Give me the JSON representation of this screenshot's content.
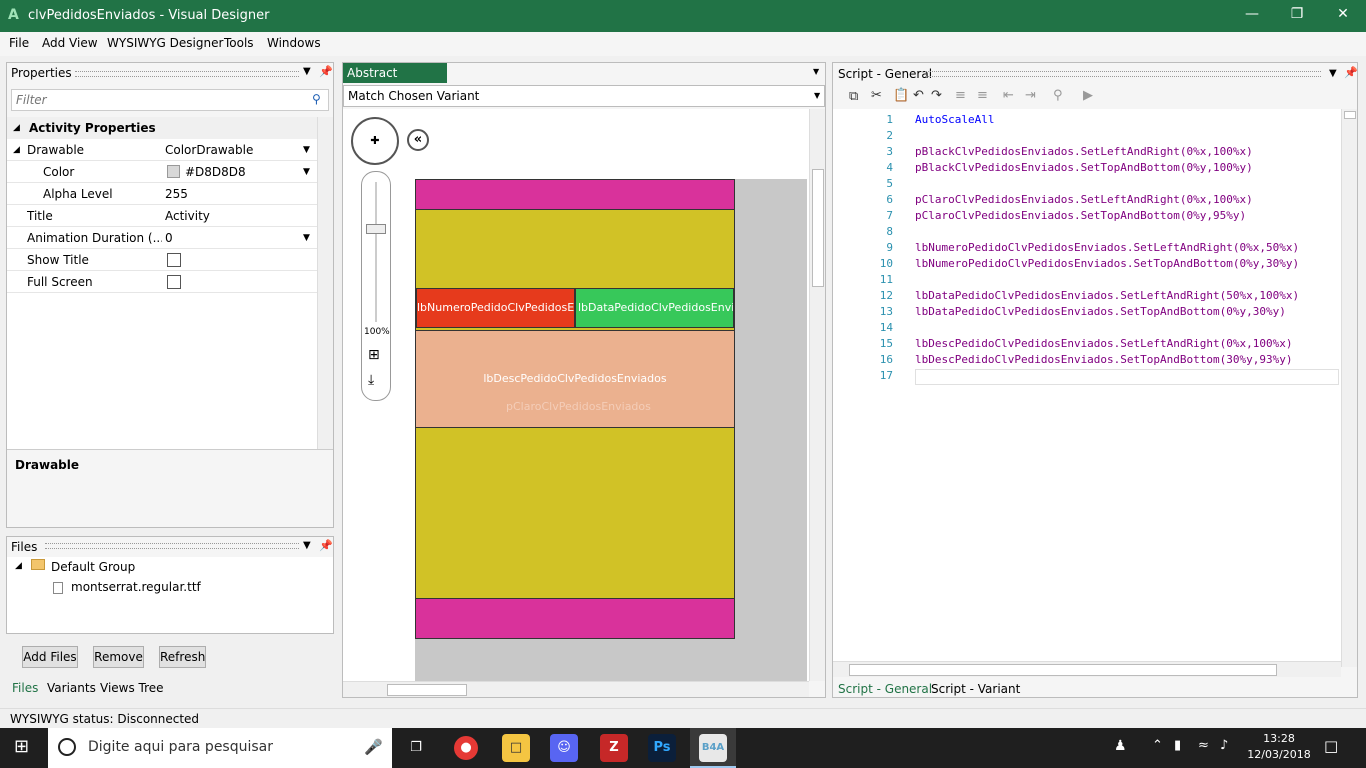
{
  "window": {
    "title": "clvPedidosEnviados - Visual Designer",
    "logo": "A"
  },
  "menu": [
    "File",
    "Add View",
    "WYSIWYG Designer",
    "Tools",
    "Windows"
  ],
  "properties": {
    "header": "Properties",
    "filter_placeholder": "Filter",
    "group": "Activity Properties",
    "rows": [
      {
        "name": "Drawable",
        "value": "ColorDrawable"
      },
      {
        "name": "Color",
        "value": "#D8D8D8"
      },
      {
        "name": "Alpha Level",
        "value": "255"
      },
      {
        "name": "Title",
        "value": "Activity"
      },
      {
        "name": "Animation Duration (...",
        "value": "0"
      },
      {
        "name": "Show Title",
        "value": ""
      },
      {
        "name": "Full Screen",
        "value": ""
      }
    ],
    "description_title": "Drawable"
  },
  "files": {
    "header": "Files",
    "group": "Default Group",
    "file": "montserrat.regular.ttf",
    "buttons": {
      "add": "Add Files",
      "remove": "Remove",
      "refresh": "Refresh"
    },
    "tabs": [
      "Files",
      "Variants",
      "Views Tree"
    ]
  },
  "designer": {
    "tab": "Abstract Designer",
    "variant": "Match Chosen Variant",
    "zoom": "100%",
    "labels": {
      "numero": "lbNumeroPedidoClvPedidosEnviados",
      "data": "lbDataPedidoClvPedidosEnviados",
      "desc": "lbDescPedidoClvPedidosEnviados",
      "claro": "pClaroClvPedidosEnviados"
    },
    "colors": {
      "magenta": "#d9329b",
      "olive": "#d1c226",
      "red": "#e63a1c",
      "green": "#37c85a",
      "peach": "#ebb18f",
      "bg": "#c8c8c8"
    }
  },
  "script": {
    "header": "Script - General",
    "tabs": [
      "Script - General",
      "Script - Variant"
    ],
    "lines": [
      "AutoScaleAll",
      "",
      "pBlackClvPedidosEnviados.SetLeftAndRight(0%x,100%x)",
      "pBlackClvPedidosEnviados.SetTopAndBottom(0%y,100%y)",
      "",
      "pClaroClvPedidosEnviados.SetLeftAndRight(0%x,100%x)",
      "pClaroClvPedidosEnviados.SetTopAndBottom(0%y,95%y)",
      "",
      "lbNumeroPedidoClvPedidosEnviados.SetLeftAndRight(0%x,50%x)",
      "lbNumeroPedidoClvPedidosEnviados.SetTopAndBottom(0%y,30%y)",
      "",
      "lbDataPedidoClvPedidosEnviados.SetLeftAndRight(50%x,100%x)",
      "lbDataPedidoClvPedidosEnviados.SetTopAndBottom(0%y,30%y)",
      "",
      "lbDescPedidoClvPedidosEnviados.SetLeftAndRight(0%x,100%x)",
      "lbDescPedidoClvPedidosEnviados.SetTopAndBottom(30%y,93%y)",
      ""
    ]
  },
  "status": "WYSIWYG status: Disconnected",
  "taskbar": {
    "search": "Digite aqui para pesquisar",
    "time": "13:28",
    "date": "12/03/2018"
  }
}
